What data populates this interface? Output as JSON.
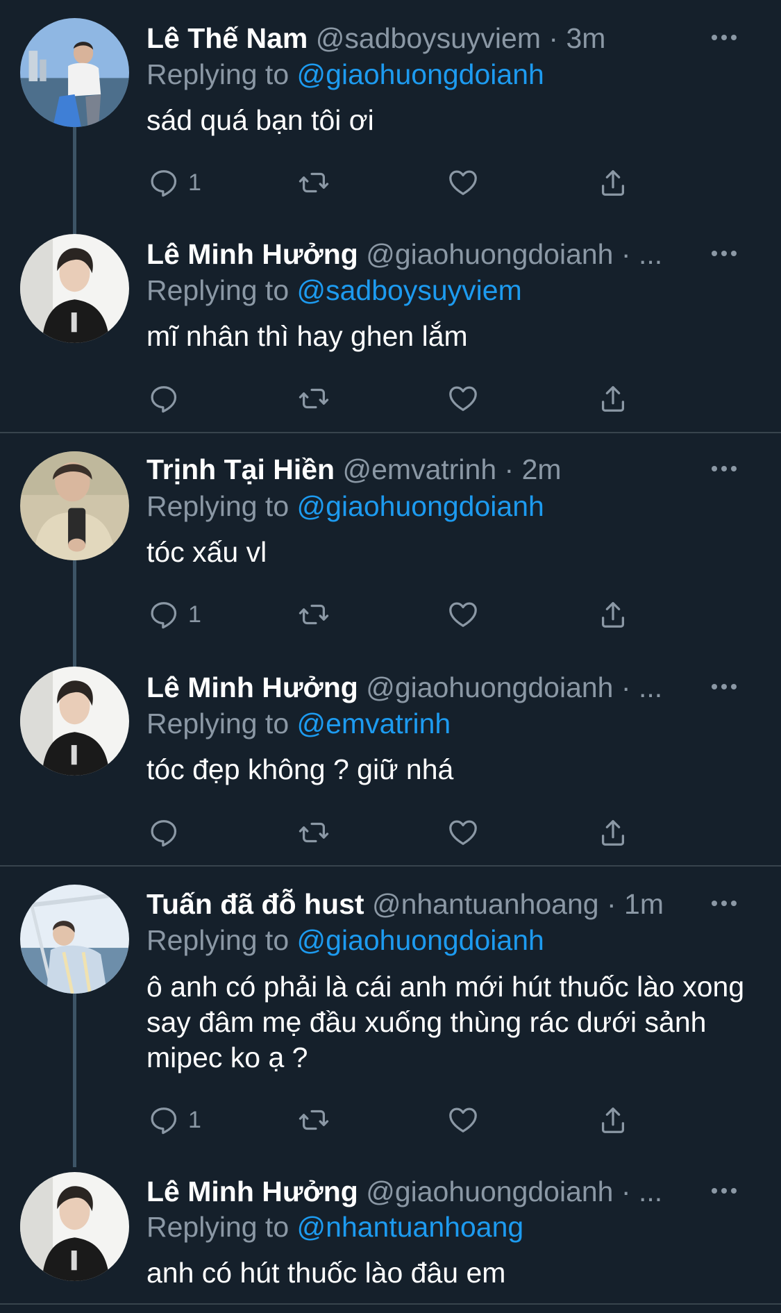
{
  "tweets": [
    {
      "name": "Lê Thế Nam",
      "handle": "@sadboysuyviem",
      "time": "· 3m",
      "replying_label": "Replying to",
      "replying_to": "@giaohuongdoianh",
      "text": "sád quá bạn tôi ơi",
      "reply_count": "1"
    },
    {
      "name": "Lê Minh Hưởng",
      "handle": "@giaohuongdoianh",
      "time": "· ...",
      "replying_label": "Replying to",
      "replying_to": "@sadboysuyviem",
      "text": "mĩ nhân thì hay ghen lắm",
      "reply_count": ""
    },
    {
      "name": "Trịnh Tại Hiền",
      "handle": "@emvatrinh",
      "time": "· 2m",
      "replying_label": "Replying to",
      "replying_to": "@giaohuongdoianh",
      "text": "tóc xấu vl",
      "reply_count": "1"
    },
    {
      "name": "Lê Minh Hưởng",
      "handle": "@giaohuongdoianh",
      "time": "· ...",
      "replying_label": "Replying to",
      "replying_to": "@emvatrinh",
      "text": "tóc đẹp không ? giữ nhá",
      "reply_count": ""
    },
    {
      "name": "Tuấn đã đỗ hust",
      "handle": "@nhantuanhoang",
      "time": "· 1m",
      "replying_label": "Replying to",
      "replying_to": "@giaohuongdoianh",
      "text": "ô anh có phải là cái anh mới hút thuốc lào xong say đâm mẹ đầu xuống thùng rác dưới sảnh mipec ko ạ ?",
      "reply_count": "1"
    },
    {
      "name": "Lê Minh Hưởng",
      "handle": "@giaohuongdoianh",
      "time": "· ...",
      "replying_label": "Replying to",
      "replying_to": "@nhantuanhoang",
      "text": "anh có hút thuốc lào đâu em",
      "reply_count": ""
    }
  ],
  "icons": {
    "reply": "reply-icon",
    "retweet": "retweet-icon",
    "like": "heart-icon",
    "share": "share-icon",
    "more": "more-icon"
  },
  "colors": {
    "background": "#15202b",
    "mention": "#1d9bf0",
    "secondary_text": "#8b98a5",
    "divider": "#38444d"
  }
}
